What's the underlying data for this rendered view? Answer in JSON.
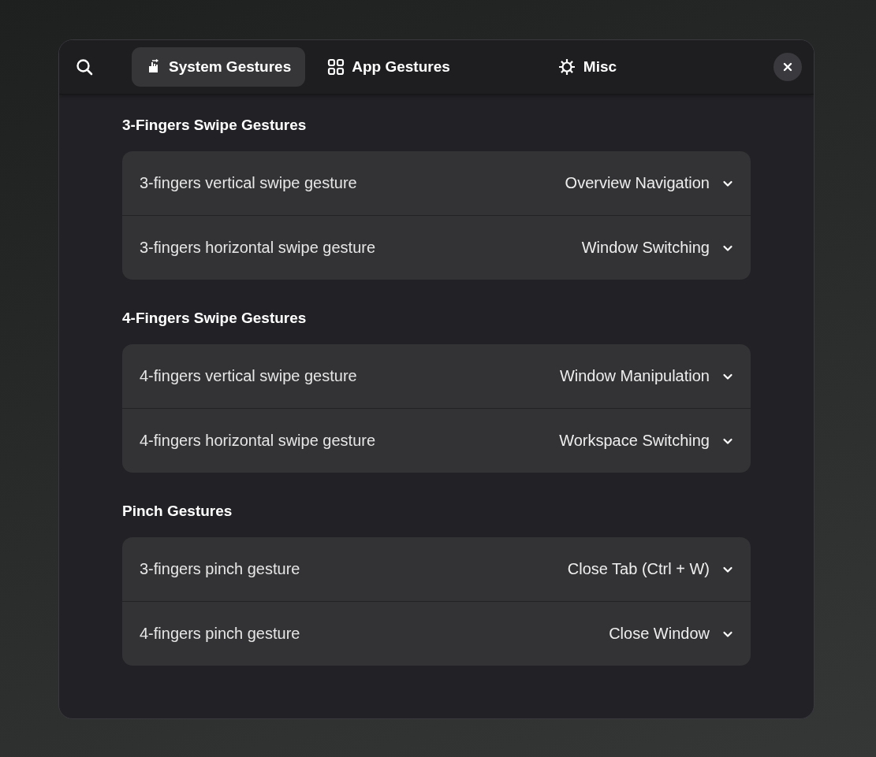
{
  "tabs": [
    {
      "label": "System Gestures",
      "selected": true
    },
    {
      "label": "App Gestures",
      "selected": false
    },
    {
      "label": "Misc",
      "selected": false
    }
  ],
  "sections": [
    {
      "title": "3-Fingers Swipe Gestures",
      "rows": [
        {
          "label": "3-fingers vertical swipe gesture",
          "value": "Overview Navigation"
        },
        {
          "label": "3-fingers horizontal swipe gesture",
          "value": "Window Switching"
        }
      ]
    },
    {
      "title": "4-Fingers Swipe Gestures",
      "rows": [
        {
          "label": "4-fingers vertical swipe gesture",
          "value": "Window Manipulation"
        },
        {
          "label": "4-fingers horizontal swipe gesture",
          "value": "Workspace Switching"
        }
      ]
    },
    {
      "title": "Pinch Gestures",
      "rows": [
        {
          "label": "3-fingers pinch gesture",
          "value": "Close Tab (Ctrl + W)"
        },
        {
          "label": "4-fingers pinch gesture",
          "value": "Close Window"
        }
      ]
    }
  ]
}
